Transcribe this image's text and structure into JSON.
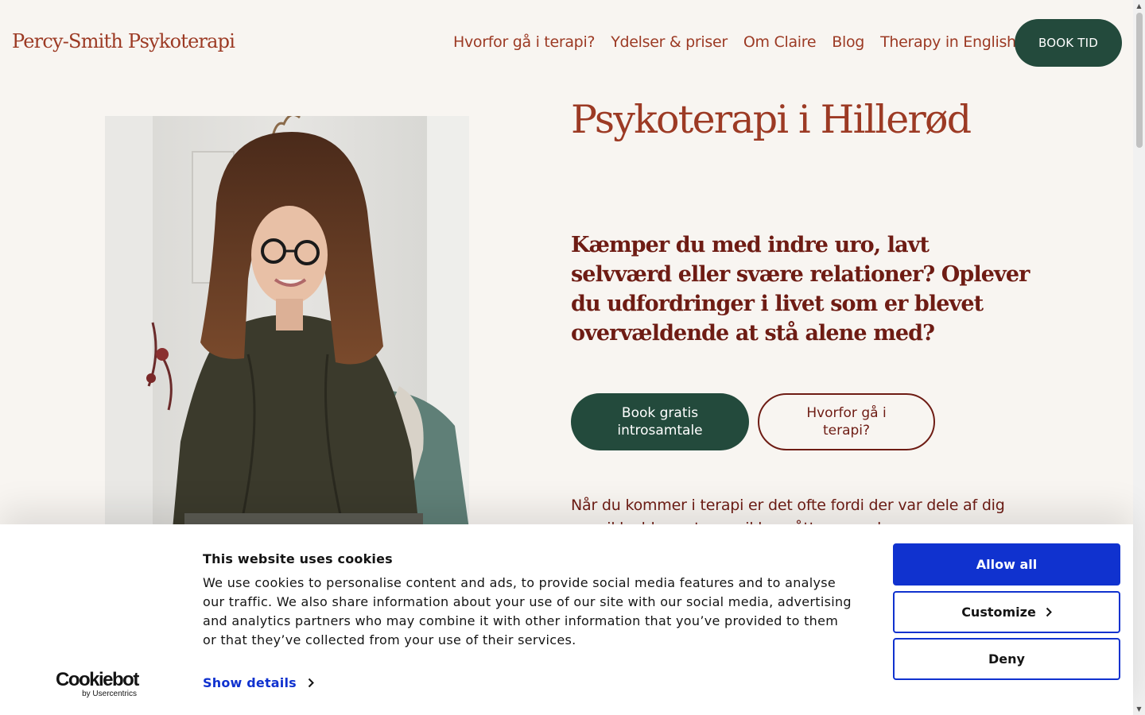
{
  "header": {
    "logo": "Percy-Smith Psykoterapi",
    "nav": [
      {
        "label": "Hvorfor gå i terapi?"
      },
      {
        "label": "Ydelser & priser"
      },
      {
        "label": "Om Claire"
      },
      {
        "label": "Blog"
      },
      {
        "label": "Therapy in English"
      }
    ],
    "book_label": "BOOK TID"
  },
  "hero": {
    "title": "Psykoterapi i Hillerød",
    "lead": "Kæmper du med indre uro, lavt selvværd eller svære relationer? Oplever du udfordringer i livet som er blevet overvældende at stå alene med?",
    "primary_button": "Book gratis introsamtale",
    "secondary_button": "Hvorfor gå i terapi?",
    "body": "Når du kommer i terapi er det ofte fordi der var dele af dig som ikke blev set, som ikke måtte være der."
  },
  "cookie_banner": {
    "logo": "Cookiebot",
    "logo_sub": "by Usercentrics",
    "title": "This website uses cookies",
    "text": "We use cookies to personalise content and ads, to provide social media features and to analyse our traffic. We also share information about your use of our site with our social media, advertising and analytics partners who may combine it with other information that you’ve provided to them or that they’ve collected from your use of their services.",
    "show_details": "Show details",
    "allow_all": "Allow all",
    "customize": "Customize",
    "deny": "Deny"
  },
  "colors": {
    "background": "#f8f5f1",
    "brand_red": "#9c3a24",
    "dark_red": "#6e1c14",
    "green": "#234a3c",
    "cookie_blue": "#1032cf"
  }
}
